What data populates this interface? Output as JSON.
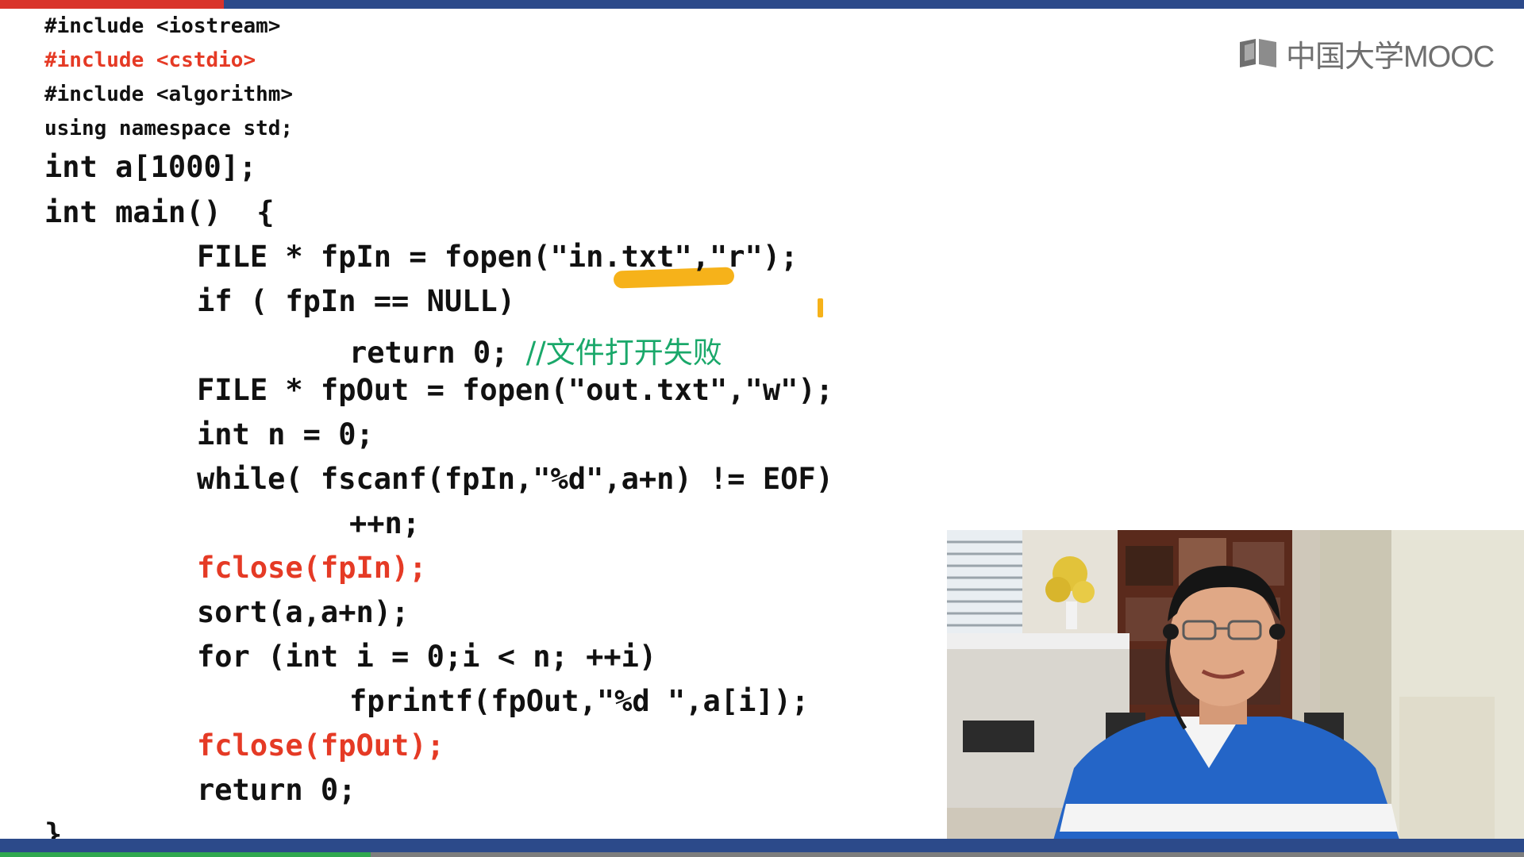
{
  "brand": {
    "logo_text": "中国大学MOOC"
  },
  "video": {
    "progress_fraction": 0.243
  },
  "code": {
    "line1": "#include <iostream>",
    "line2": "#include <cstdio>",
    "line3": "#include <algorithm>",
    "line4": "using namespace std;",
    "line5": "int a[1000];",
    "line6": "int main()  {",
    "line7": "FILE * fpIn = fopen(\"in.txt\",\"r\");",
    "line8": "if ( fpIn == NULL)",
    "line9": "return 0;",
    "line9_comment": "//文件打开失败",
    "line10": "FILE * fpOut = fopen(\"out.txt\",\"w\");",
    "line11": "int n = 0;",
    "line12": "while( fscanf(fpIn,\"%d\",a+n) != EOF)",
    "line13": "++n;",
    "line14": "fclose(fpIn);",
    "line15": "sort(a,a+n);",
    "line16": "for (int i = 0;i < n; ++i)",
    "line17": "fprintf(fpOut,\"%d \",a[i]);",
    "line18": "fclose(fpOut);",
    "line19": "return 0;",
    "line20": "}"
  },
  "colors": {
    "bar_blue": "#2c4a8a",
    "accent_red": "#d9342b",
    "code_red": "#e53a25",
    "comment_green": "#1aa86a",
    "highlight": "#f6b21a"
  }
}
